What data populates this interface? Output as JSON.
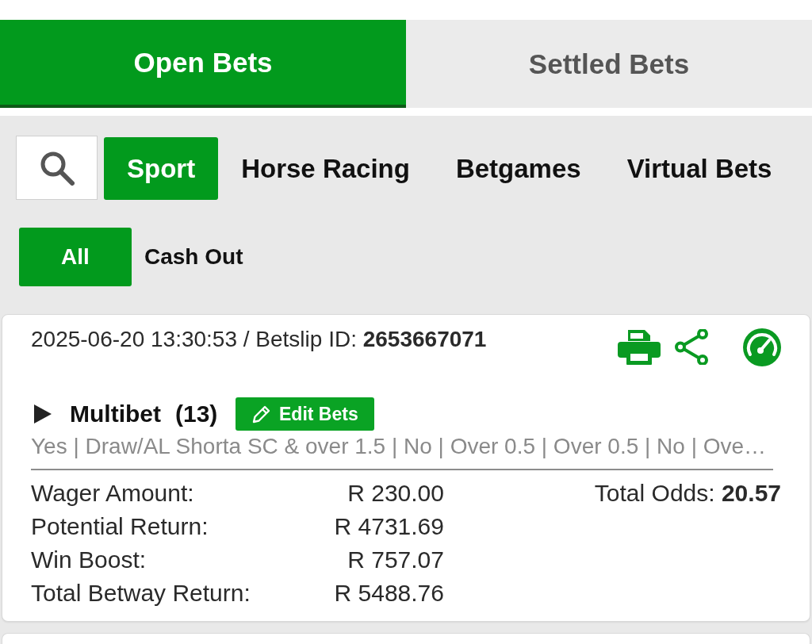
{
  "tabs": [
    {
      "label": "Open Bets",
      "selected": true
    },
    {
      "label": "Settled Bets",
      "selected": false
    }
  ],
  "categories": [
    {
      "label": "Sport",
      "selected": true
    },
    {
      "label": "Horse Racing",
      "selected": false
    },
    {
      "label": "Betgames",
      "selected": false
    },
    {
      "label": "Virtual Bets",
      "selected": false
    }
  ],
  "filters": [
    {
      "label": "All",
      "selected": true
    },
    {
      "label": "Cash Out",
      "selected": false
    }
  ],
  "bet": {
    "header": "2025-06-20 13:30:53 / Betslip ID: **2653667071**",
    "expanded": false,
    "bet_type": "Multibet",
    "leg_count": "(13)",
    "edit_button": "Edit Bets",
    "selections": "Yes | Draw/AL Shorta SC & over 1.5 | No | Over 0.5 | Over 0.5 | No | Ove…",
    "amounts": [
      {
        "label": "Wager Amount:",
        "value": "R 230.00"
      },
      {
        "label": "Potential Return:",
        "value": "R 4731.69"
      },
      {
        "label": "Win Boost:",
        "value": "R 757.07"
      },
      {
        "label": "Total Betway Return:",
        "value": "R 5488.76"
      }
    ],
    "total_odds": "Total Odds: **20.57**"
  }
}
